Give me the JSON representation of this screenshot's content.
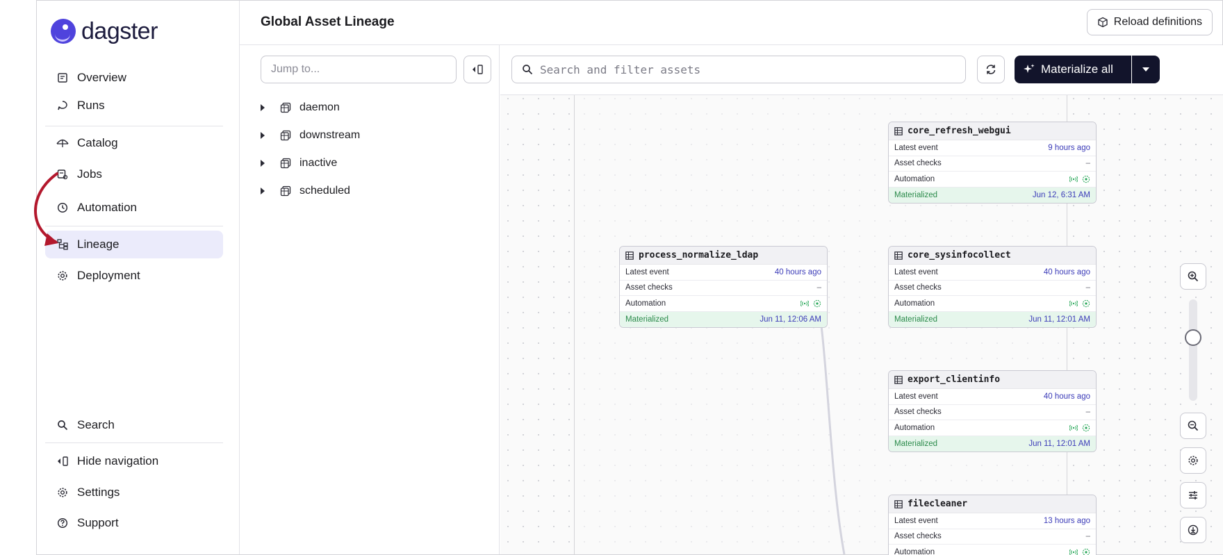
{
  "app": {
    "logo_text": "dagster"
  },
  "sidebar": {
    "items": [
      {
        "label": "Overview"
      },
      {
        "label": "Runs"
      },
      {
        "label": "Catalog"
      },
      {
        "label": "Jobs"
      },
      {
        "label": "Automation"
      },
      {
        "label": "Lineage"
      },
      {
        "label": "Deployment"
      }
    ],
    "bottom": [
      {
        "label": "Search"
      },
      {
        "label": "Hide navigation"
      },
      {
        "label": "Settings"
      },
      {
        "label": "Support"
      }
    ],
    "active": "Lineage"
  },
  "header": {
    "title": "Global Asset Lineage",
    "reload_label": "Reload definitions"
  },
  "tree": {
    "jump_placeholder": "Jump to...",
    "groups": [
      {
        "label": "daemon"
      },
      {
        "label": "downstream"
      },
      {
        "label": "inactive"
      },
      {
        "label": "scheduled"
      }
    ]
  },
  "toolbar": {
    "search_placeholder": "Search and filter assets",
    "materialize_label": "Materialize all"
  },
  "labels": {
    "latest_event": "Latest event",
    "asset_checks": "Asset checks",
    "automation": "Automation",
    "materialized": "Materialized",
    "dash": "–"
  },
  "nodes": [
    {
      "name": "core_refresh_webgui",
      "latest_event": "9 hours ago",
      "materialized": "Jun 12, 6:31 AM"
    },
    {
      "name": "process_normalize_ldap",
      "latest_event": "40 hours ago",
      "materialized": "Jun 11, 12:06 AM"
    },
    {
      "name": "core_sysinfocollect",
      "latest_event": "40 hours ago",
      "materialized": "Jun 11, 12:01 AM"
    },
    {
      "name": "export_clientinfo",
      "latest_event": "40 hours ago",
      "materialized": "Jun 11, 12:01 AM"
    },
    {
      "name": "filecleaner",
      "latest_event": "13 hours ago"
    }
  ],
  "colors": {
    "accent": "#4f43dd",
    "primary_button": "#12142b",
    "active_nav": "#ebebfb",
    "materialized_bg": "#e6f6ec",
    "annotation": "#b3182d"
  }
}
